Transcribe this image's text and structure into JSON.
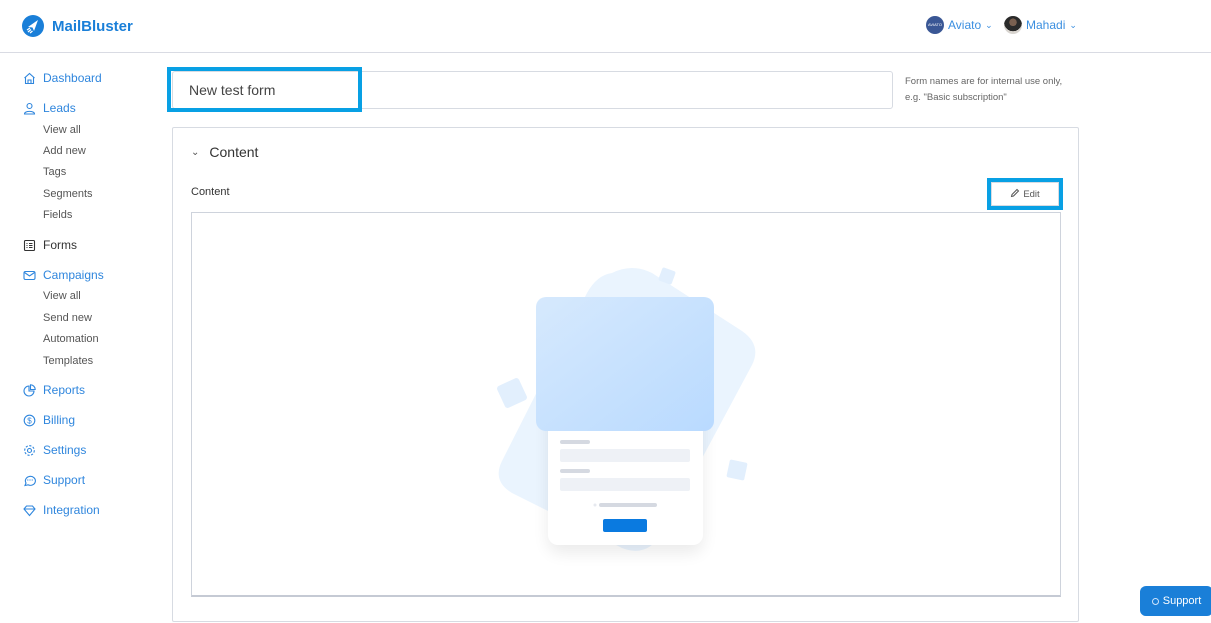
{
  "app": {
    "brand": "MailBluster",
    "brand_color": "#1a7fd8"
  },
  "header": {
    "workspace": {
      "name": "Aviato",
      "avatar_text": "AVIATO"
    },
    "user": {
      "name": "Mahadi"
    }
  },
  "sidebar": {
    "items": [
      {
        "label": "Dashboard",
        "icon": "home-icon"
      },
      {
        "label": "Leads",
        "icon": "user-icon",
        "children": [
          "View all",
          "Add new",
          "Tags",
          "Segments",
          "Fields"
        ]
      },
      {
        "label": "Forms",
        "icon": "form-icon"
      },
      {
        "label": "Campaigns",
        "icon": "envelope-icon",
        "children": [
          "View all",
          "Send new",
          "Automation",
          "Templates"
        ]
      },
      {
        "label": "Reports",
        "icon": "pie-chart-icon"
      },
      {
        "label": "Billing",
        "icon": "dollar-icon"
      },
      {
        "label": "Settings",
        "icon": "gear-icon"
      },
      {
        "label": "Support",
        "icon": "chat-icon"
      },
      {
        "label": "Integration",
        "icon": "diamond-icon"
      }
    ]
  },
  "form": {
    "name_value": "New test form",
    "name_hint_line1": "Form names are for internal use only,",
    "name_hint_line2": "e.g. \"Basic subscription\""
  },
  "content_panel": {
    "title": "Content",
    "field_label": "Content",
    "edit_label": "Edit"
  },
  "support_fab": {
    "label": "Support"
  }
}
